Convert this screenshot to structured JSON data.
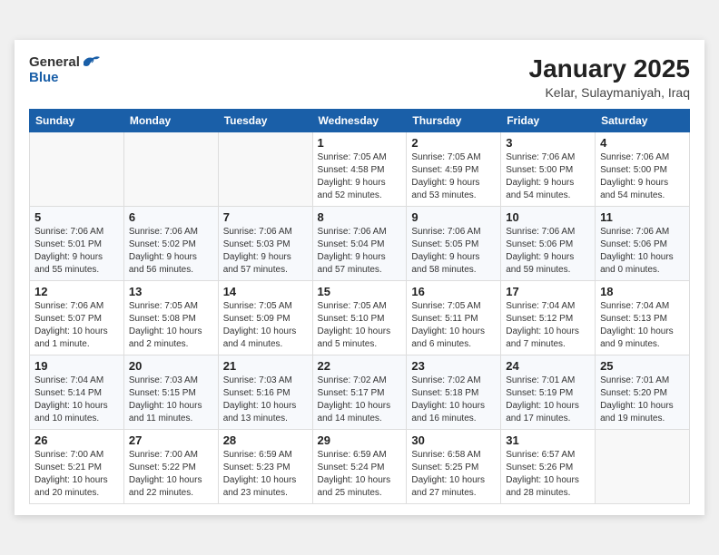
{
  "header": {
    "logo_general": "General",
    "logo_blue": "Blue",
    "month": "January 2025",
    "location": "Kelar, Sulaymaniyah, Iraq"
  },
  "weekdays": [
    "Sunday",
    "Monday",
    "Tuesday",
    "Wednesday",
    "Thursday",
    "Friday",
    "Saturday"
  ],
  "weeks": [
    [
      {
        "day": "",
        "info": ""
      },
      {
        "day": "",
        "info": ""
      },
      {
        "day": "",
        "info": ""
      },
      {
        "day": "1",
        "info": "Sunrise: 7:05 AM\nSunset: 4:58 PM\nDaylight: 9 hours\nand 52 minutes."
      },
      {
        "day": "2",
        "info": "Sunrise: 7:05 AM\nSunset: 4:59 PM\nDaylight: 9 hours\nand 53 minutes."
      },
      {
        "day": "3",
        "info": "Sunrise: 7:06 AM\nSunset: 5:00 PM\nDaylight: 9 hours\nand 54 minutes."
      },
      {
        "day": "4",
        "info": "Sunrise: 7:06 AM\nSunset: 5:00 PM\nDaylight: 9 hours\nand 54 minutes."
      }
    ],
    [
      {
        "day": "5",
        "info": "Sunrise: 7:06 AM\nSunset: 5:01 PM\nDaylight: 9 hours\nand 55 minutes."
      },
      {
        "day": "6",
        "info": "Sunrise: 7:06 AM\nSunset: 5:02 PM\nDaylight: 9 hours\nand 56 minutes."
      },
      {
        "day": "7",
        "info": "Sunrise: 7:06 AM\nSunset: 5:03 PM\nDaylight: 9 hours\nand 57 minutes."
      },
      {
        "day": "8",
        "info": "Sunrise: 7:06 AM\nSunset: 5:04 PM\nDaylight: 9 hours\nand 57 minutes."
      },
      {
        "day": "9",
        "info": "Sunrise: 7:06 AM\nSunset: 5:05 PM\nDaylight: 9 hours\nand 58 minutes."
      },
      {
        "day": "10",
        "info": "Sunrise: 7:06 AM\nSunset: 5:06 PM\nDaylight: 9 hours\nand 59 minutes."
      },
      {
        "day": "11",
        "info": "Sunrise: 7:06 AM\nSunset: 5:06 PM\nDaylight: 10 hours\nand 0 minutes."
      }
    ],
    [
      {
        "day": "12",
        "info": "Sunrise: 7:06 AM\nSunset: 5:07 PM\nDaylight: 10 hours\nand 1 minute."
      },
      {
        "day": "13",
        "info": "Sunrise: 7:05 AM\nSunset: 5:08 PM\nDaylight: 10 hours\nand 2 minutes."
      },
      {
        "day": "14",
        "info": "Sunrise: 7:05 AM\nSunset: 5:09 PM\nDaylight: 10 hours\nand 4 minutes."
      },
      {
        "day": "15",
        "info": "Sunrise: 7:05 AM\nSunset: 5:10 PM\nDaylight: 10 hours\nand 5 minutes."
      },
      {
        "day": "16",
        "info": "Sunrise: 7:05 AM\nSunset: 5:11 PM\nDaylight: 10 hours\nand 6 minutes."
      },
      {
        "day": "17",
        "info": "Sunrise: 7:04 AM\nSunset: 5:12 PM\nDaylight: 10 hours\nand 7 minutes."
      },
      {
        "day": "18",
        "info": "Sunrise: 7:04 AM\nSunset: 5:13 PM\nDaylight: 10 hours\nand 9 minutes."
      }
    ],
    [
      {
        "day": "19",
        "info": "Sunrise: 7:04 AM\nSunset: 5:14 PM\nDaylight: 10 hours\nand 10 minutes."
      },
      {
        "day": "20",
        "info": "Sunrise: 7:03 AM\nSunset: 5:15 PM\nDaylight: 10 hours\nand 11 minutes."
      },
      {
        "day": "21",
        "info": "Sunrise: 7:03 AM\nSunset: 5:16 PM\nDaylight: 10 hours\nand 13 minutes."
      },
      {
        "day": "22",
        "info": "Sunrise: 7:02 AM\nSunset: 5:17 PM\nDaylight: 10 hours\nand 14 minutes."
      },
      {
        "day": "23",
        "info": "Sunrise: 7:02 AM\nSunset: 5:18 PM\nDaylight: 10 hours\nand 16 minutes."
      },
      {
        "day": "24",
        "info": "Sunrise: 7:01 AM\nSunset: 5:19 PM\nDaylight: 10 hours\nand 17 minutes."
      },
      {
        "day": "25",
        "info": "Sunrise: 7:01 AM\nSunset: 5:20 PM\nDaylight: 10 hours\nand 19 minutes."
      }
    ],
    [
      {
        "day": "26",
        "info": "Sunrise: 7:00 AM\nSunset: 5:21 PM\nDaylight: 10 hours\nand 20 minutes."
      },
      {
        "day": "27",
        "info": "Sunrise: 7:00 AM\nSunset: 5:22 PM\nDaylight: 10 hours\nand 22 minutes."
      },
      {
        "day": "28",
        "info": "Sunrise: 6:59 AM\nSunset: 5:23 PM\nDaylight: 10 hours\nand 23 minutes."
      },
      {
        "day": "29",
        "info": "Sunrise: 6:59 AM\nSunset: 5:24 PM\nDaylight: 10 hours\nand 25 minutes."
      },
      {
        "day": "30",
        "info": "Sunrise: 6:58 AM\nSunset: 5:25 PM\nDaylight: 10 hours\nand 27 minutes."
      },
      {
        "day": "31",
        "info": "Sunrise: 6:57 AM\nSunset: 5:26 PM\nDaylight: 10 hours\nand 28 minutes."
      },
      {
        "day": "",
        "info": ""
      }
    ]
  ]
}
